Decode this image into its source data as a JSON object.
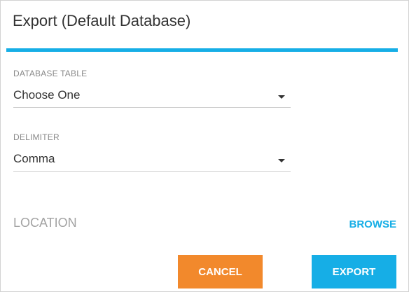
{
  "dialog": {
    "title": "Export (Default Database)"
  },
  "fields": {
    "database_table": {
      "label": "DATABASE TABLE",
      "value": "Choose One",
      "icon": "caret-down-icon"
    },
    "delimiter": {
      "label": "DELIMITER",
      "value": "Comma",
      "icon": "caret-down-icon"
    }
  },
  "location": {
    "label": "LOCATION",
    "browse_label": "BROWSE"
  },
  "actions": {
    "cancel_label": "CANCEL",
    "export_label": "EXPORT"
  },
  "colors": {
    "accent": "#16aee6",
    "cancel": "#f2892c",
    "text": "#333333",
    "muted": "#8a8a8a"
  }
}
